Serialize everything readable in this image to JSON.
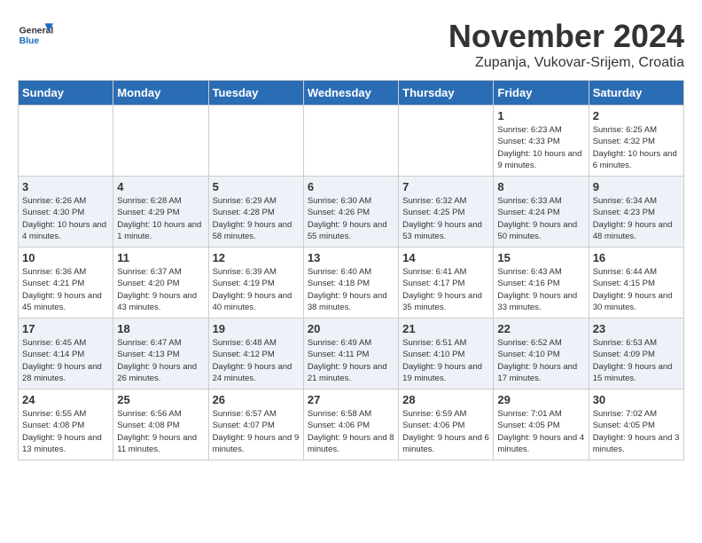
{
  "header": {
    "logo": {
      "general": "General",
      "blue": "Blue"
    },
    "title": "November 2024",
    "location": "Zupanja, Vukovar-Srijem, Croatia"
  },
  "columns": [
    "Sunday",
    "Monday",
    "Tuesday",
    "Wednesday",
    "Thursday",
    "Friday",
    "Saturday"
  ],
  "weeks": [
    [
      {
        "day": "",
        "info": ""
      },
      {
        "day": "",
        "info": ""
      },
      {
        "day": "",
        "info": ""
      },
      {
        "day": "",
        "info": ""
      },
      {
        "day": "",
        "info": ""
      },
      {
        "day": "1",
        "info": "Sunrise: 6:23 AM\nSunset: 4:33 PM\nDaylight: 10 hours and 9 minutes."
      },
      {
        "day": "2",
        "info": "Sunrise: 6:25 AM\nSunset: 4:32 PM\nDaylight: 10 hours and 6 minutes."
      }
    ],
    [
      {
        "day": "3",
        "info": "Sunrise: 6:26 AM\nSunset: 4:30 PM\nDaylight: 10 hours and 4 minutes."
      },
      {
        "day": "4",
        "info": "Sunrise: 6:28 AM\nSunset: 4:29 PM\nDaylight: 10 hours and 1 minute."
      },
      {
        "day": "5",
        "info": "Sunrise: 6:29 AM\nSunset: 4:28 PM\nDaylight: 9 hours and 58 minutes."
      },
      {
        "day": "6",
        "info": "Sunrise: 6:30 AM\nSunset: 4:26 PM\nDaylight: 9 hours and 55 minutes."
      },
      {
        "day": "7",
        "info": "Sunrise: 6:32 AM\nSunset: 4:25 PM\nDaylight: 9 hours and 53 minutes."
      },
      {
        "day": "8",
        "info": "Sunrise: 6:33 AM\nSunset: 4:24 PM\nDaylight: 9 hours and 50 minutes."
      },
      {
        "day": "9",
        "info": "Sunrise: 6:34 AM\nSunset: 4:23 PM\nDaylight: 9 hours and 48 minutes."
      }
    ],
    [
      {
        "day": "10",
        "info": "Sunrise: 6:36 AM\nSunset: 4:21 PM\nDaylight: 9 hours and 45 minutes."
      },
      {
        "day": "11",
        "info": "Sunrise: 6:37 AM\nSunset: 4:20 PM\nDaylight: 9 hours and 43 minutes."
      },
      {
        "day": "12",
        "info": "Sunrise: 6:39 AM\nSunset: 4:19 PM\nDaylight: 9 hours and 40 minutes."
      },
      {
        "day": "13",
        "info": "Sunrise: 6:40 AM\nSunset: 4:18 PM\nDaylight: 9 hours and 38 minutes."
      },
      {
        "day": "14",
        "info": "Sunrise: 6:41 AM\nSunset: 4:17 PM\nDaylight: 9 hours and 35 minutes."
      },
      {
        "day": "15",
        "info": "Sunrise: 6:43 AM\nSunset: 4:16 PM\nDaylight: 9 hours and 33 minutes."
      },
      {
        "day": "16",
        "info": "Sunrise: 6:44 AM\nSunset: 4:15 PM\nDaylight: 9 hours and 30 minutes."
      }
    ],
    [
      {
        "day": "17",
        "info": "Sunrise: 6:45 AM\nSunset: 4:14 PM\nDaylight: 9 hours and 28 minutes."
      },
      {
        "day": "18",
        "info": "Sunrise: 6:47 AM\nSunset: 4:13 PM\nDaylight: 9 hours and 26 minutes."
      },
      {
        "day": "19",
        "info": "Sunrise: 6:48 AM\nSunset: 4:12 PM\nDaylight: 9 hours and 24 minutes."
      },
      {
        "day": "20",
        "info": "Sunrise: 6:49 AM\nSunset: 4:11 PM\nDaylight: 9 hours and 21 minutes."
      },
      {
        "day": "21",
        "info": "Sunrise: 6:51 AM\nSunset: 4:10 PM\nDaylight: 9 hours and 19 minutes."
      },
      {
        "day": "22",
        "info": "Sunrise: 6:52 AM\nSunset: 4:10 PM\nDaylight: 9 hours and 17 minutes."
      },
      {
        "day": "23",
        "info": "Sunrise: 6:53 AM\nSunset: 4:09 PM\nDaylight: 9 hours and 15 minutes."
      }
    ],
    [
      {
        "day": "24",
        "info": "Sunrise: 6:55 AM\nSunset: 4:08 PM\nDaylight: 9 hours and 13 minutes."
      },
      {
        "day": "25",
        "info": "Sunrise: 6:56 AM\nSunset: 4:08 PM\nDaylight: 9 hours and 11 minutes."
      },
      {
        "day": "26",
        "info": "Sunrise: 6:57 AM\nSunset: 4:07 PM\nDaylight: 9 hours and 9 minutes."
      },
      {
        "day": "27",
        "info": "Sunrise: 6:58 AM\nSunset: 4:06 PM\nDaylight: 9 hours and 8 minutes."
      },
      {
        "day": "28",
        "info": "Sunrise: 6:59 AM\nSunset: 4:06 PM\nDaylight: 9 hours and 6 minutes."
      },
      {
        "day": "29",
        "info": "Sunrise: 7:01 AM\nSunset: 4:05 PM\nDaylight: 9 hours and 4 minutes."
      },
      {
        "day": "30",
        "info": "Sunrise: 7:02 AM\nSunset: 4:05 PM\nDaylight: 9 hours and 3 minutes."
      }
    ]
  ]
}
